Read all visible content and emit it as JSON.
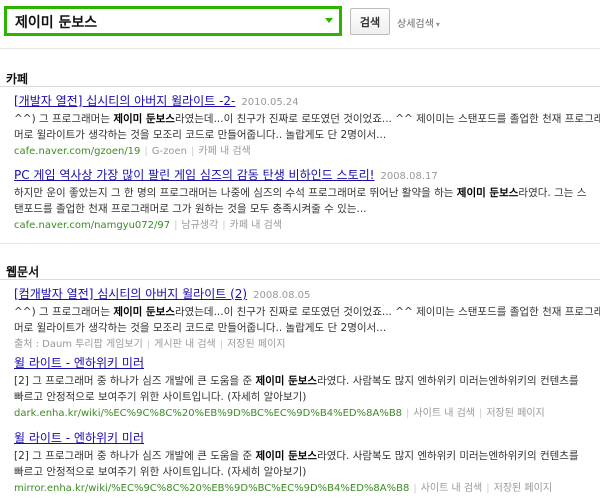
{
  "search": {
    "query": "제이미 둔보스",
    "button_label": "검색",
    "detail_label": "상세검색"
  },
  "sections": [
    {
      "title": "카페",
      "results": [
        {
          "title": "[개발자 열전] 십시티의 아버지 윌라이트 -2-",
          "date": "2010.05.24",
          "snippet_lines": [
            [
              "^^) 그 프로그래머는 ",
              {
                "b": "제이미 둔보스"
              },
              "라였는데...이 친구가 진짜로 로또였던 것이었죠... ^^ 제이미는 스탠포드를 졸업한 천재 프로그래"
            ],
            [
              "머로 윌라이트가 생각하는 것을 모조리 코드로 만들어줍니다.. 놀랍게도 단 2명이서..."
            ]
          ],
          "url": "cafe.naver.com/gzoen/19",
          "source": "G-zoen",
          "extra_link": "카페 내 검색"
        },
        {
          "title": "PC 게임 역사상 가장 많이 팔린 게임 심즈의 감동 탄생 비하인드 스토리!",
          "date": "2008.08.17",
          "snippet_lines": [
            [
              "하지만 운이 좋았는지 그 한 명의 프로그래머는 나중에 심즈의 수석 프로그래머로 뛰어난 활약을 하는 ",
              {
                "b": "제이미 둔보스"
              },
              "라였다. 그는 스"
            ],
            [
              "탠포드를 졸업한 천재 프로그래머로 그가 원하는 것을 모두 충족시켜줄 수 있는..."
            ]
          ],
          "url": "cafe.naver.com/namgyu072/97",
          "source": "남규생각",
          "extra_link": "카페 내 검색"
        }
      ]
    },
    {
      "title": "웹문서",
      "results": [
        {
          "title": "[컴개발자 열전] 심시티의 아버지 윌라이트 (2)",
          "date": "2008.08.05",
          "snippet_lines": [
            [
              "^^) 그 프로그래머는 ",
              {
                "b": "제이미 둔보스"
              },
              "라였는데...이 친구가 진짜로 로또였던 것이었죠... ^^ 제이미는 스탠포드를 졸업한 천재 프로그래"
            ],
            [
              "머로 윌라이트가 생각하는 것을 모조리 코드로 만들어줍니다.. 놀랍게도 단 2명이서..."
            ]
          ],
          "url": "",
          "source": "출처 : Daum 투리팝 게임보기",
          "extra_link": "게시판 내 검색",
          "extra_link2": "저장된 페이지"
        },
        {
          "title": "윌 라이트 - 엔하위키 미러",
          "date": "",
          "snippet_lines": [
            [
              "[2] 그 프로그래머 중 하나가 심즈 개발에 큰 도움을 준 ",
              {
                "b": "제이미 둔보스"
              },
              "라였다. 사람복도 많지 엔하위키 미러는엔하위키의 컨텐츠를"
            ],
            [
              "빠르고 안정적으로 보여주기 위한 사이트입니다. (자세히 알아보기)"
            ]
          ],
          "url": "dark.enha.kr/wiki/%EC%9C%8C%20%EB%9D%BC%EC%9D%B4%ED%8A%B8",
          "source": "",
          "extra_link": "사이트 내 검색",
          "extra_link2": "저장된 페이지"
        },
        {
          "title": "윌 라이트 - 엔하위키 미러",
          "date": "",
          "snippet_lines": [
            [
              "[2] 그 프로그래머 중 하나가 심즈 개발에 큰 도움을 준 ",
              {
                "b": "제이미 둔보스"
              },
              "라였다. 사람복도 많지 엔하위키 미러는엔하위키의 컨텐츠를"
            ],
            [
              "빠르고 안정적으로 보여주기 위한 사이트입니다. (자세히 알아보기)"
            ]
          ],
          "url": "mirror.enha.kr/wiki/%EC%9C%8C%20%EB%9D%BC%EC%9D%B4%ED%8A%B8",
          "source": "",
          "extra_link": "사이트 내 검색",
          "extra_link2": "저장된 페이지"
        }
      ]
    }
  ],
  "colors": {
    "search_border": "#2db400",
    "link": "#1a0dab",
    "url": "#3b8b24"
  }
}
